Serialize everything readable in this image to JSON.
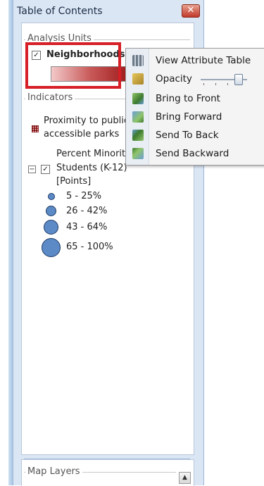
{
  "window": {
    "title": "Table of Contents",
    "close_glyph": "✕"
  },
  "analysis_units": {
    "group_label": "Analysis Units",
    "layer_label": "Neighborhoods",
    "checked": true
  },
  "indicators": {
    "group_label": "Indicators",
    "items": [
      {
        "label_line1": "Proximity to public",
        "label_line2": "accessible parks",
        "icon": "grid-icon"
      },
      {
        "label_line1": "Percent Minorit",
        "label_line2": "Students (K-12)",
        "label_line3": "[Points]",
        "checked": true,
        "expanded": true
      }
    ],
    "legend": [
      {
        "label": "5 - 25%"
      },
      {
        "label": "26 - 42%"
      },
      {
        "label": "43 - 64%"
      },
      {
        "label": "65 - 100%"
      }
    ]
  },
  "map_layers": {
    "group_label": "Map Layers",
    "scroll_glyph": "▲"
  },
  "context_menu": {
    "items": [
      {
        "label": "View Attribute Table",
        "icon": "table-icon"
      },
      {
        "label": "Opacity",
        "icon": "opacity-icon"
      },
      {
        "label": "Bring to Front",
        "icon": "bring-to-front-icon"
      },
      {
        "label": "Bring Forward",
        "icon": "bring-forward-icon"
      },
      {
        "label": "Send To Back",
        "icon": "send-to-back-icon"
      },
      {
        "label": "Send Backward",
        "icon": "send-backward-icon"
      }
    ],
    "opacity_value": 0.8
  },
  "colors": {
    "highlight": "#d61f26",
    "legend_point": "#5b8ac6",
    "gradient_start": "#f3c9c9",
    "gradient_end": "#9e1a1a"
  }
}
